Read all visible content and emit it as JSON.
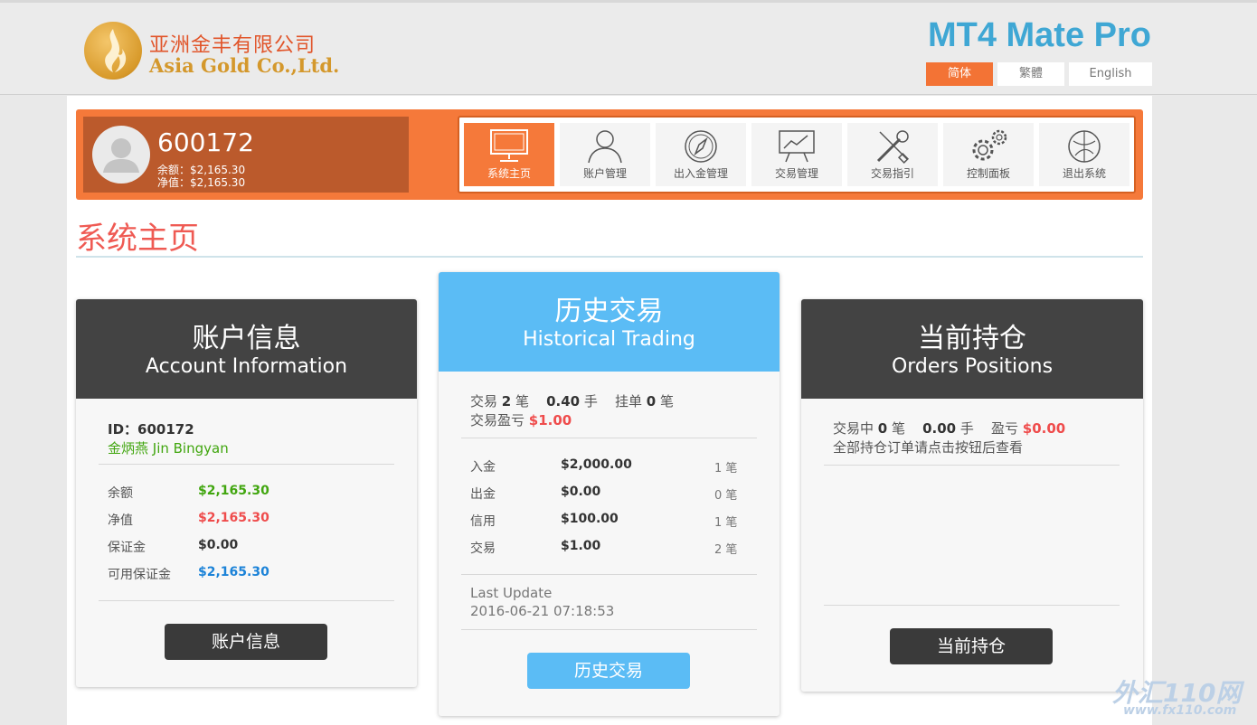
{
  "brand": {
    "name_cn": "亚洲金丰有限公司",
    "name_en": "Asia Gold Co.,Ltd.",
    "app_title": "MT4 Mate Pro"
  },
  "languages": [
    {
      "label": "简体",
      "active": true
    },
    {
      "label": "繁體",
      "active": false
    },
    {
      "label": "English",
      "active": false
    }
  ],
  "user": {
    "account": "600172",
    "balance_line": "余额：$2,165.30",
    "equity_line": "净值：$2,165.30"
  },
  "nav": [
    {
      "label": "系统主页",
      "icon": "monitor-icon",
      "active": true
    },
    {
      "label": "账户管理",
      "icon": "user-icon"
    },
    {
      "label": "出入金管理",
      "icon": "compass-icon"
    },
    {
      "label": "交易管理",
      "icon": "chart-board-icon"
    },
    {
      "label": "交易指引",
      "icon": "tools-icon"
    },
    {
      "label": "控制面板",
      "icon": "gears-icon"
    },
    {
      "label": "退出系统",
      "icon": "exit-icon"
    }
  ],
  "page_title": "系统主页",
  "account_card": {
    "title_cn": "账户信息",
    "title_en": "Account Information",
    "id_line": "ID：600172",
    "name": "金炳燕 Jin Bingyan",
    "rows": [
      {
        "label": "余额",
        "value": "$2,165.30",
        "color": "#41a60f"
      },
      {
        "label": "净值",
        "value": "$2,165.30",
        "color": "#ef4c4c"
      },
      {
        "label": "保证金",
        "value": "$0.00",
        "color": "#333333"
      },
      {
        "label": "可用保证金",
        "value": "$2,165.30",
        "color": "#1c83d8"
      }
    ],
    "button": "账户信息"
  },
  "history_card": {
    "title_cn": "历史交易",
    "title_en": "Historical Trading",
    "summary": {
      "trades_label": "交易",
      "trades": "2",
      "unit_bi": "笔",
      "lots": "0.40",
      "unit_lot": "手",
      "pending_label": "挂单",
      "pending": "0",
      "unit_bi2": "笔",
      "pl_label": "交易盈亏",
      "pl": "$1.00"
    },
    "rows": [
      {
        "label": "入金",
        "value": "$2,000.00",
        "count": "1 笔"
      },
      {
        "label": "出金",
        "value": "$0.00",
        "count": "0 笔"
      },
      {
        "label": "信用",
        "value": "$100.00",
        "count": "1 笔"
      },
      {
        "label": "交易",
        "value": "$1.00",
        "count": "2 笔"
      }
    ],
    "last_update_label": "Last Update",
    "last_update": "2016-06-21 07:18:53",
    "button": "历史交易"
  },
  "positions_card": {
    "title_cn": "当前持仓",
    "title_en": "Orders Positions",
    "summary": {
      "open_label": "交易中",
      "open": "0",
      "unit_bi": "笔",
      "lots": "0.00",
      "unit_lot": "手",
      "pl_label": "盈亏",
      "pl": "$0.00"
    },
    "note": "全部持仓订单请点击按钮后查看",
    "button": "当前持仓"
  },
  "watermark": {
    "main": "外汇110网",
    "url": "www.fx110.com"
  }
}
